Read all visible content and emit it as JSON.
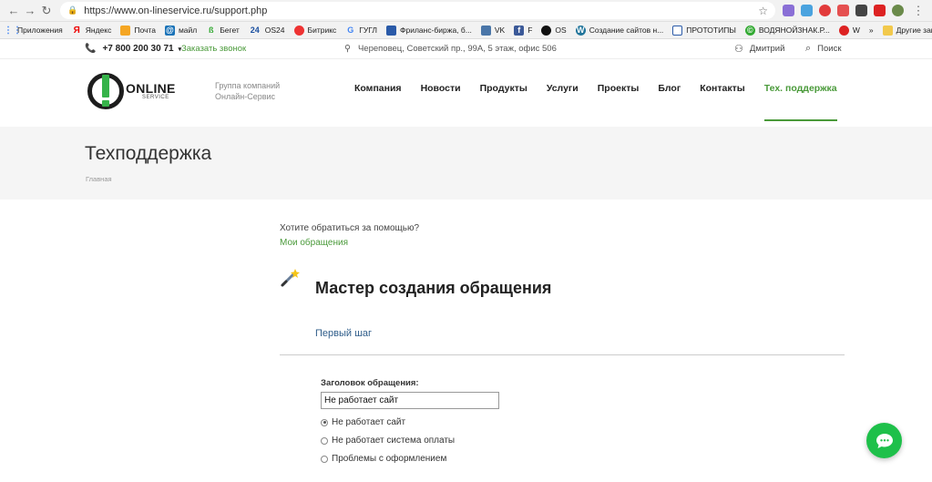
{
  "browser": {
    "url": "https://www.on-lineservice.ru/support.php",
    "bookmarks": [
      "Приложения",
      "Яндекс",
      "Почта",
      "майл",
      "Бегет",
      "OS24",
      "Битрикс",
      "ГУГЛ",
      "Фриланс-биржа, б...",
      "VK",
      "F",
      "OS",
      "Создание сайтов н...",
      "ПРОТОТИПЫ",
      "ВОДЯНОЙЗНАК.Р...",
      "W"
    ],
    "overflow": "»",
    "other_bookmarks": "Другие заклад"
  },
  "topbar": {
    "phone": "+7 800 200 30 71",
    "callback": "Заказать звонок",
    "address": "Череповец, Советский пр., 99А, 5 этаж, офис 506",
    "user": "Дмитрий",
    "search": "Поиск"
  },
  "header": {
    "logo_big": "ONLINE",
    "logo_small": "SERVICE",
    "tagline_1": "Группа компаний",
    "tagline_2": "Онлайн-Сервис",
    "menu": [
      "Компания",
      "Новости",
      "Продукты",
      "Услуги",
      "Проекты",
      "Блог",
      "Контакты",
      "Тех. поддержка"
    ]
  },
  "page": {
    "title": "Техподдержка",
    "breadcrumb": "Главная"
  },
  "content": {
    "help_question": "Хотите обратиться за помощью?",
    "my_requests": "Мои обращения",
    "wizard_title": "Мастер создания обращения",
    "step": "Первый шаг",
    "field_label": "Заголовок обращения:",
    "field_value": "Не работает сайт",
    "options": [
      "Не работает сайт",
      "Не работает система оплаты",
      "Проблемы с оформлением"
    ],
    "selected_option": 0
  },
  "colors": {
    "brand_green": "#4a9a3a",
    "chat_green": "#1ec04a"
  }
}
